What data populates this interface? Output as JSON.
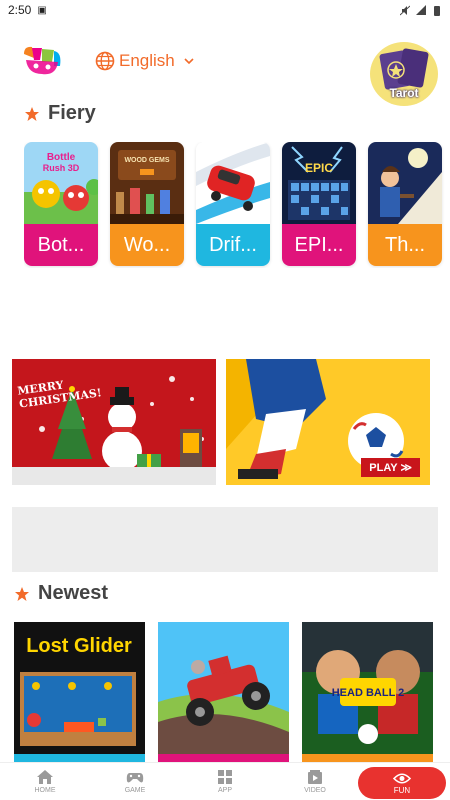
{
  "status_bar": {
    "time": "2:50"
  },
  "header": {
    "language_label": "English",
    "tarot_label": "Tarot"
  },
  "sections": {
    "fiery": {
      "title": "Fiery",
      "games": [
        {
          "name": "Bot...",
          "color": "#e0137b"
        },
        {
          "name": "Wo...",
          "color": "#f7941d"
        },
        {
          "name": "Drif...",
          "color": "#1fb7e0"
        },
        {
          "name": "EPI...",
          "color": "#e0137b"
        },
        {
          "name": "Th...",
          "color": "#f7941d"
        }
      ]
    },
    "banners": {
      "left_text_line1": "MERRY",
      "left_text_line2": "CHRISTMAS!",
      "right_play_label": "PLAY ≫"
    },
    "newest": {
      "title": "Newest",
      "games": [
        {
          "thumb_text": "Lost Glider",
          "strip_color": "#1fb7e0"
        },
        {
          "thumb_text": "",
          "strip_color": "#e0137b"
        },
        {
          "thumb_text": "HEAD BALL 2",
          "strip_color": "#f7941d"
        }
      ]
    }
  },
  "bottom_nav": {
    "items": [
      {
        "label": "HOME"
      },
      {
        "label": "GAME"
      },
      {
        "label": "APP"
      },
      {
        "label": "VIDEO"
      },
      {
        "label": "FUN"
      }
    ],
    "active_color": "#e8322f"
  },
  "colors": {
    "accent": "#f26b2a",
    "pink": "#e0137b",
    "orange": "#f7941d",
    "blue": "#1fb7e0"
  }
}
